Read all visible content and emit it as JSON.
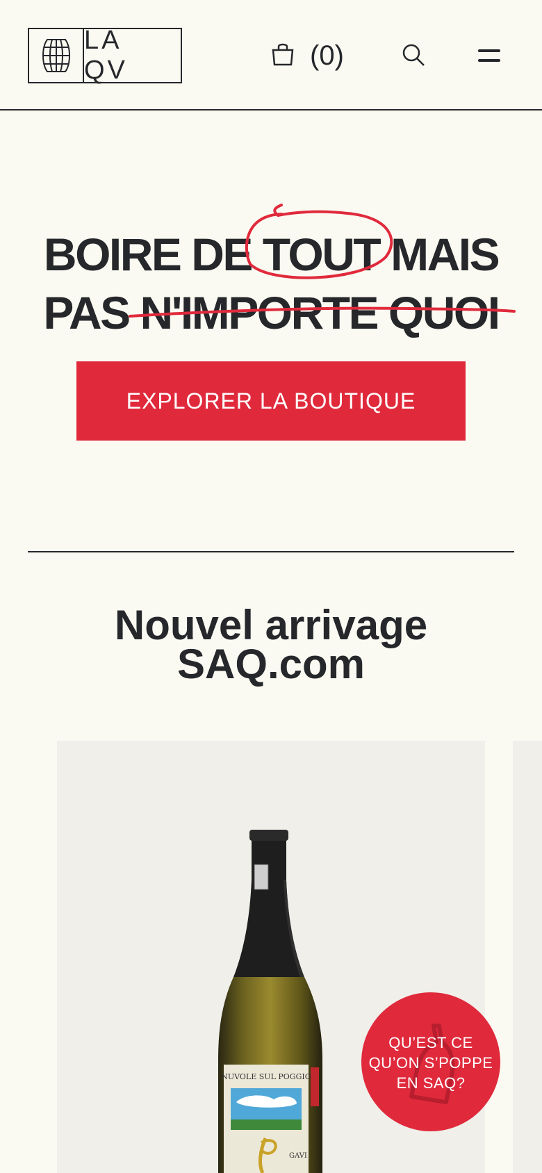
{
  "header": {
    "logo_text": "LA QV",
    "logo_icon": "barrel-icon",
    "cart_icon": "shopping-bag-icon",
    "cart_count": "(0)",
    "search_icon": "search-icon",
    "menu_icon": "menu-icon"
  },
  "hero": {
    "line1_part1": "BOIRE DE ",
    "line1_circled": "TOUT",
    "line1_part2": " MAIS",
    "line2_part1": "PAS ",
    "line2_struck": "N'IMPORTE QUOI",
    "cta_label": "EXPLORER LA BOUTIQUE"
  },
  "section": {
    "title_line1": "Nouvel arrivage",
    "title_line2": "SAQ.com"
  },
  "product": {
    "label_producer": "NUVOLE SUL POGGIO",
    "label_name": "GAVI"
  },
  "bubble": {
    "line1": "QU’EST CE",
    "line2": "QU’ON S’POPPE",
    "line3": "EN SAQ?"
  },
  "colors": {
    "background": "#FBFAF2",
    "ink": "#25272B",
    "accent_red": "#E02A3C",
    "card_bg": "#F0EFEA"
  }
}
